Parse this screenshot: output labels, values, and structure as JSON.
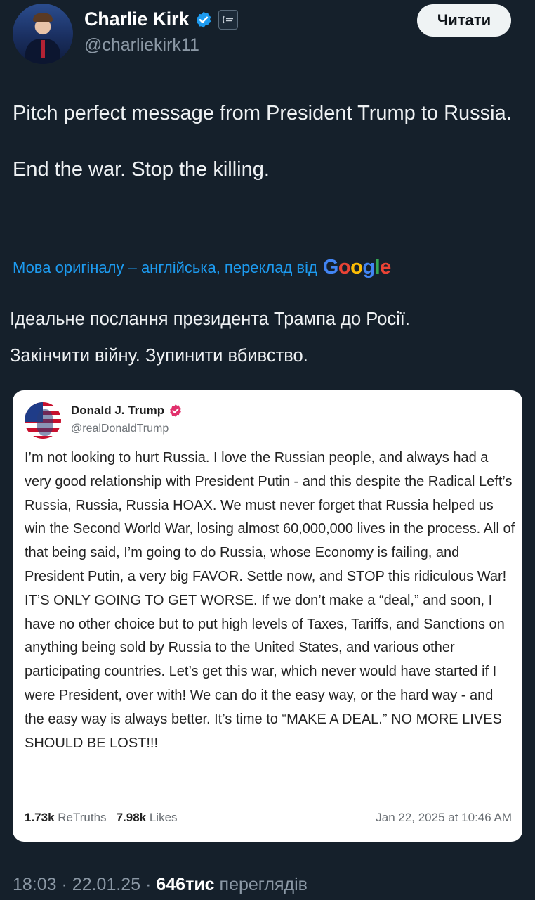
{
  "author": {
    "name": "Charlie Kirk",
    "handle": "@charliekirk11",
    "verified_color": "#1d9bf0"
  },
  "follow_button": {
    "label": "Читати"
  },
  "tweet": {
    "lines": [
      "Pitch perfect message from President Trump to Russia.",
      "End the war. Stop the killing."
    ]
  },
  "translation": {
    "note": "Мова оригіналу – англійська, переклад від",
    "provider_logo": "Google",
    "lines": [
      "Ідеальне послання президента Трампа до Росії.",
      "Закінчити війну. Зупинити вбивство."
    ]
  },
  "quoted_post": {
    "name": "Donald J. Trump",
    "handle": "@realDonaldTrump",
    "badge_color": "#e1306c",
    "body": "I’m not looking to hurt Russia. I love the Russian people, and always had a very good relationship with President Putin - and this despite the Radical Left’s Russia, Russia, Russia HOAX. We must never forget that Russia helped us win the Second World War, losing almost 60,000,000 lives in the process. All of that being said, I’m going to do Russia, whose Economy is failing, and President Putin, a very big FAVOR. Settle now, and STOP this ridiculous War! IT’S ONLY GOING TO GET WORSE. If we don’t make a “deal,” and soon, I have no other choice but to put high levels of Taxes, Tariffs, and Sanctions on anything being sold by Russia to the United States, and various other participating countries. Let’s get this war, which never would have started if I were President, over with! We can do it the easy way, or the hard way - and the easy way is always better. It’s time to “MAKE A DEAL.” NO MORE LIVES SHOULD BE LOST!!!",
    "retruths_count": "1.73k",
    "retruths_label": "ReTruths",
    "likes_count": "7.98k",
    "likes_label": "Likes",
    "date": "Jan 22, 2025 at 10:46 AM"
  },
  "meta": {
    "time": "18:03",
    "separator": "·",
    "date": "22.01.25",
    "views_count": "646тис",
    "views_label": "переглядів"
  }
}
